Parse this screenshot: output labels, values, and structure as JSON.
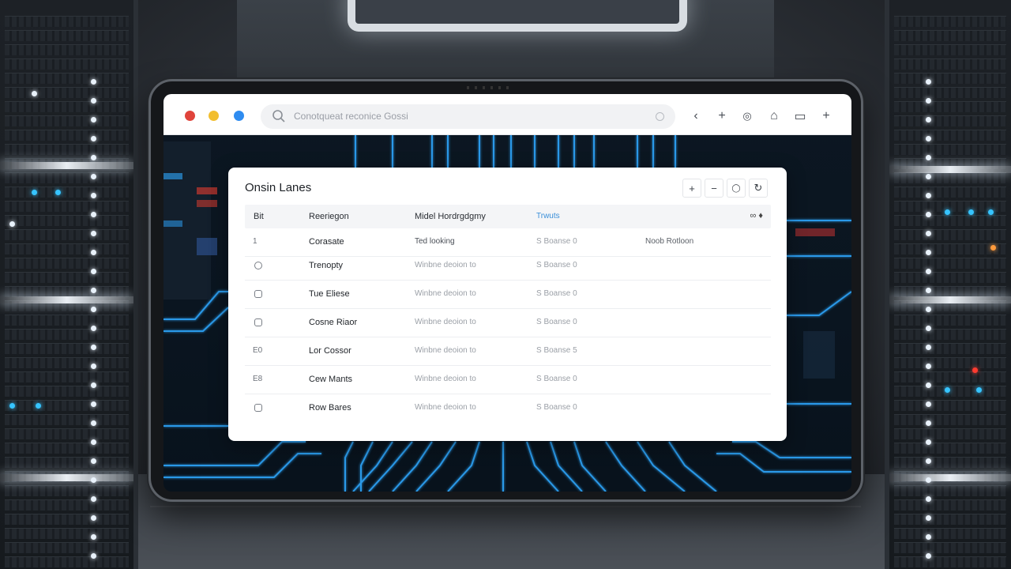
{
  "browser": {
    "address_text": "Conotqueat reconice Gossi",
    "toolbar_icons": [
      "back-icon",
      "new-tab-icon",
      "settings-icon",
      "home-icon",
      "bookmark-icon",
      "add-icon"
    ],
    "glyphs": {
      "back": "‹",
      "plus": "+",
      "settings": "◎",
      "home": "⌂",
      "bookmark": "▭",
      "add": "+"
    }
  },
  "panel": {
    "title": "Onsin Lanes",
    "tools": {
      "add": "+",
      "remove": "−",
      "search": "◯",
      "refresh": "↻"
    },
    "head_icons": "∞ ♦"
  },
  "table": {
    "columns": [
      "Bit",
      "Reeriegon",
      "Midel Hordrgdgmy",
      "Trwuts"
    ],
    "rows": [
      {
        "id": "1",
        "name": "Corasate",
        "description": "Ted looking",
        "status": "S Boanse 0",
        "extra": "Noob Rotloon"
      },
      {
        "id": "",
        "name": "Trenopty",
        "description": "Winbne deoion to",
        "status": "S Boanse 0",
        "extra": ""
      },
      {
        "id": "",
        "name": "Tue Eliese",
        "description": "Winbne deoion to",
        "status": "S Boanse 0",
        "extra": ""
      },
      {
        "id": "",
        "name": "Cosne Riaor",
        "description": "Winbne deoion to",
        "status": "S Boanse 0",
        "extra": ""
      },
      {
        "id": "E0",
        "name": "Lor Cossor",
        "description": "Winbne deoion to",
        "status": "S Boanse 5",
        "extra": ""
      },
      {
        "id": "E8",
        "name": "Cew Mants",
        "description": "Winbne deoion to",
        "status": "S Boanse 0",
        "extra": ""
      },
      {
        "id": "",
        "name": "Row Bares",
        "description": "Winbne deoion to",
        "status": "S Boanse 0",
        "extra": ""
      }
    ]
  },
  "colors": {
    "accent": "#3a8fd9",
    "traffic_red": "#e0443b",
    "traffic_yellow": "#f2be2f",
    "traffic_blue": "#2f8cf0",
    "circuit": "#2ea8ff"
  }
}
